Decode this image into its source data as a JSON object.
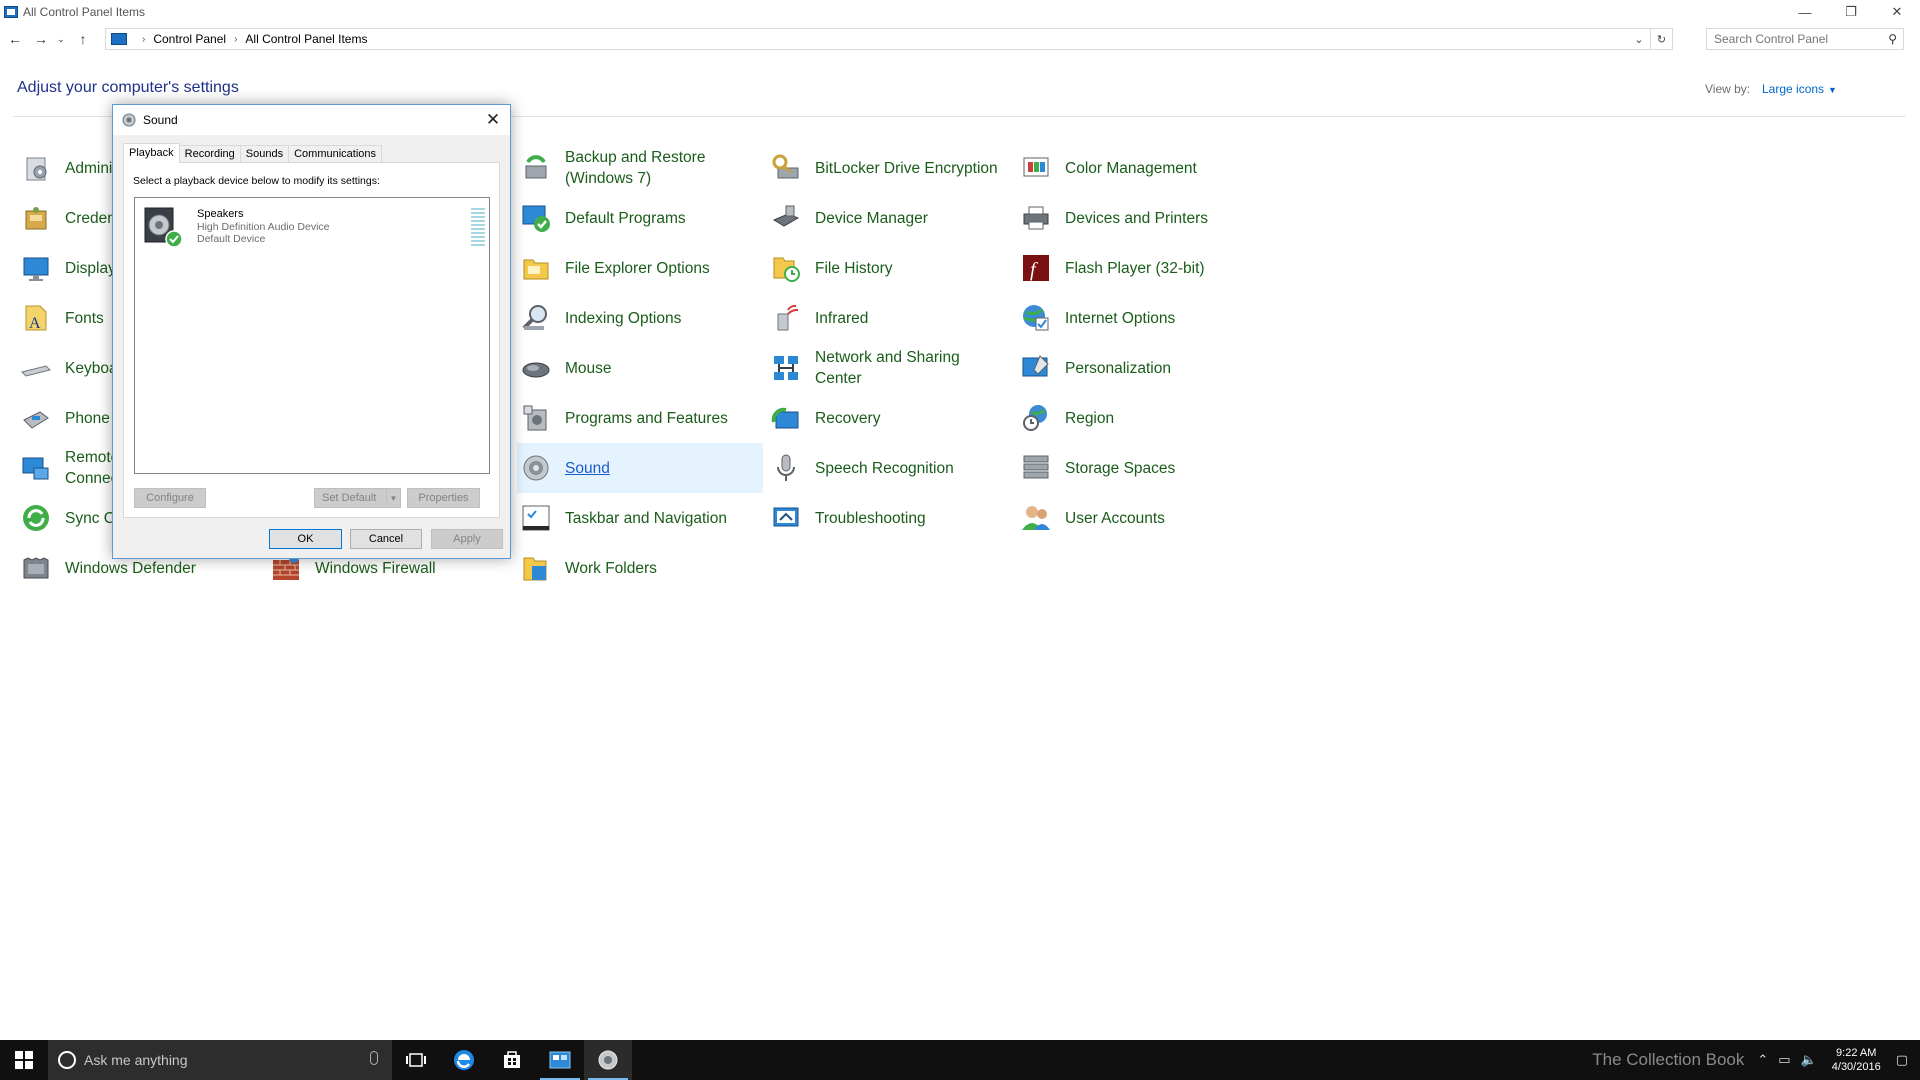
{
  "window": {
    "title": "All Control Panel Items",
    "controls": {
      "minimize": "—",
      "restore": "❐",
      "close": "✕"
    }
  },
  "address": {
    "crumbs": [
      "Control Panel",
      "All Control Panel Items"
    ],
    "search_placeholder": "Search Control Panel"
  },
  "header": {
    "title": "Adjust your computer's settings",
    "viewby_label": "View by:",
    "viewby_value": "Large icons"
  },
  "items": {
    "col1": [
      {
        "label": "Admini",
        "icon": "administrative-tools-icon"
      },
      {
        "label": "Creden",
        "icon": "credential-manager-icon"
      },
      {
        "label": "Display",
        "icon": "display-icon"
      },
      {
        "label": "Fonts",
        "icon": "fonts-icon"
      },
      {
        "label": "Keyboa",
        "icon": "keyboard-icon"
      },
      {
        "label": "Phone",
        "icon": "phone-icon"
      },
      {
        "label": "Remote\nConnec",
        "icon": "remote-connections-icon"
      },
      {
        "label": "Sync C",
        "icon": "sync-center-icon"
      },
      {
        "label": "Windows Defender",
        "icon": "windows-defender-icon"
      }
    ],
    "col2": [
      {
        "label": "Windows Firewall",
        "icon": "windows-firewall-icon"
      }
    ],
    "col3": [
      {
        "label": "Backup and Restore\n(Windows 7)",
        "icon": "backup-restore-icon"
      },
      {
        "label": "Default Programs",
        "icon": "default-programs-icon"
      },
      {
        "label": "File Explorer Options",
        "icon": "file-explorer-options-icon"
      },
      {
        "label": "Indexing Options",
        "icon": "indexing-options-icon"
      },
      {
        "label": "Mouse",
        "icon": "mouse-icon"
      },
      {
        "label": "Programs and Features",
        "icon": "programs-features-icon"
      },
      {
        "label": "Sound",
        "icon": "sound-icon"
      },
      {
        "label": "Taskbar and Navigation",
        "icon": "taskbar-navigation-icon"
      },
      {
        "label": "Work Folders",
        "icon": "work-folders-icon"
      }
    ],
    "col4": [
      {
        "label": "BitLocker Drive Encryption",
        "icon": "bitlocker-icon"
      },
      {
        "label": "Device Manager",
        "icon": "device-manager-icon"
      },
      {
        "label": "File History",
        "icon": "file-history-icon"
      },
      {
        "label": "Infrared",
        "icon": "infrared-icon"
      },
      {
        "label": "Network and Sharing\nCenter",
        "icon": "network-sharing-icon"
      },
      {
        "label": "Recovery",
        "icon": "recovery-icon"
      },
      {
        "label": "Speech Recognition",
        "icon": "microphone-icon"
      },
      {
        "label": "Troubleshooting",
        "icon": "troubleshooting-icon"
      }
    ],
    "col5": [
      {
        "label": "Color Management",
        "icon": "color-management-icon"
      },
      {
        "label": "Devices and Printers",
        "icon": "printer-icon"
      },
      {
        "label": "Flash Player (32-bit)",
        "icon": "flash-player-icon"
      },
      {
        "label": "Internet Options",
        "icon": "internet-options-icon"
      },
      {
        "label": "Personalization",
        "icon": "personalization-icon"
      },
      {
        "label": "Region",
        "icon": "region-icon"
      },
      {
        "label": "Storage Spaces",
        "icon": "storage-spaces-icon"
      },
      {
        "label": "User Accounts",
        "icon": "user-accounts-icon"
      }
    ]
  },
  "dialog": {
    "title": "Sound",
    "tabs": [
      "Playback",
      "Recording",
      "Sounds",
      "Communications"
    ],
    "instruction": "Select a playback device below to modify its settings:",
    "device": {
      "name": "Speakers",
      "description": "High Definition Audio Device",
      "status": "Default Device"
    },
    "buttons": {
      "configure": "Configure",
      "set_default": "Set Default",
      "properties": "Properties",
      "ok": "OK",
      "cancel": "Cancel",
      "apply": "Apply"
    }
  },
  "taskbar": {
    "search_placeholder": "Ask me anything",
    "watermark": "The Collection Book",
    "time": "9:22 AM",
    "date": "4/30/2016"
  },
  "colors": {
    "link_green": "#1a5c1a",
    "title_blue": "#1e3287",
    "accent": "#0078d7",
    "taskbar": "#101010"
  }
}
